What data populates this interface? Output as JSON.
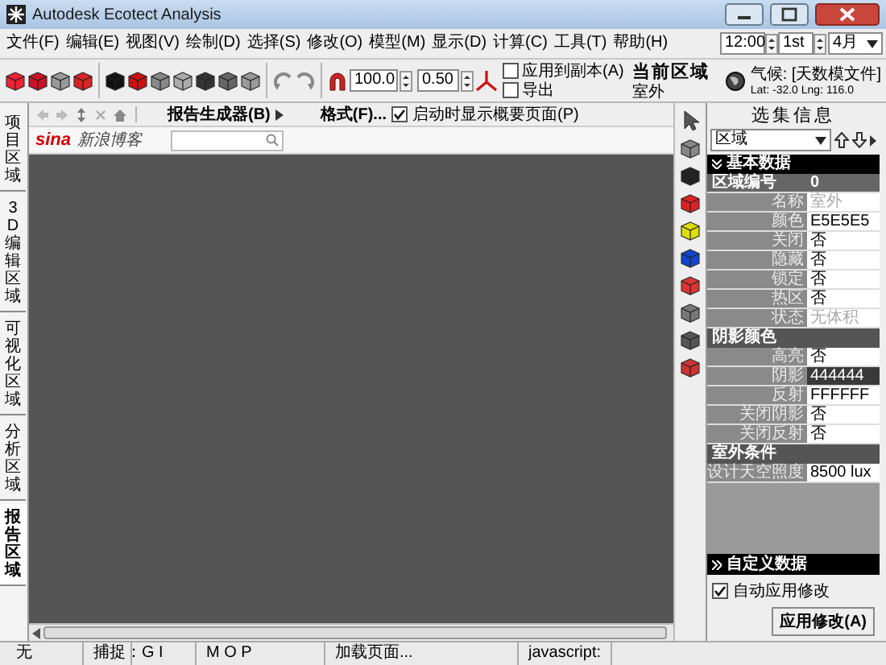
{
  "window": {
    "title": "Autodesk Ecotect Analysis"
  },
  "menu": [
    {
      "label": "文件(F)"
    },
    {
      "label": "编辑(E)"
    },
    {
      "label": "视图(V)"
    },
    {
      "label": "绘制(D)"
    },
    {
      "label": "选择(S)"
    },
    {
      "label": "修改(O)"
    },
    {
      "label": "模型(M)"
    },
    {
      "label": "显示(D)"
    },
    {
      "label": "计算(C)"
    },
    {
      "label": "工具(T)"
    },
    {
      "label": "帮助(H)"
    }
  ],
  "date_time": {
    "time": "12:00",
    "day": "1st",
    "month": "4月"
  },
  "climate": {
    "label": "气候: [天数模文件]",
    "coords": "Lat: -32.0   Lng: 116.0"
  },
  "toolbar": {
    "zoom": "100.0",
    "step": "0.50",
    "apply_copy": {
      "label": "应用到副本(A)",
      "checked": false
    },
    "export": {
      "label": "导出",
      "checked": false
    },
    "zone_title": "当前区域",
    "zone_name": "室外"
  },
  "side_tabs": [
    {
      "label": "项目区域",
      "selected": false
    },
    {
      "label": "3D编辑区域",
      "selected": false
    },
    {
      "label": "可视化区域",
      "selected": false
    },
    {
      "label": "分析区域",
      "selected": false
    },
    {
      "label": "报告区域",
      "selected": true
    }
  ],
  "report_toolbar": {
    "generator": "报告生成器(B)",
    "format": "格式(F)...",
    "show_summary": {
      "label": "启动时显示概要页面(P)",
      "checked": true
    }
  },
  "browser": {
    "logo": "sina",
    "site": "新浪博客"
  },
  "selection_panel": {
    "title": "选集信息",
    "type": "区域",
    "sections": [
      {
        "title": "基本数据",
        "kind": "main",
        "rows": [
          {
            "label": "区域编号",
            "value": "0",
            "kind": "id"
          },
          {
            "label": "名称",
            "value": "室外",
            "kind": "muted"
          },
          {
            "label": "颜色",
            "value": "E5E5E5",
            "kind": "plain"
          },
          {
            "label": "关闭",
            "value": "否",
            "kind": "plain"
          },
          {
            "label": "隐藏",
            "value": "否",
            "kind": "plain"
          },
          {
            "label": "锁定",
            "value": "否",
            "kind": "plain"
          },
          {
            "label": "热区",
            "value": "否",
            "kind": "plain"
          },
          {
            "label": "状态",
            "value": "无体积",
            "kind": "muted"
          }
        ]
      },
      {
        "title": "阴影颜色",
        "kind": "sub",
        "rows": [
          {
            "label": "高亮",
            "value": "否",
            "kind": "plain"
          },
          {
            "label": "阴影",
            "value": "444444",
            "kind": "dark"
          },
          {
            "label": "反射",
            "value": "FFFFFF",
            "kind": "plain"
          },
          {
            "label": "关闭阴影",
            "value": "否",
            "kind": "plain"
          },
          {
            "label": "关闭反射",
            "value": "否",
            "kind": "plain"
          }
        ]
      },
      {
        "title": "室外条件",
        "kind": "sub",
        "rows": [
          {
            "label": "设计天空照度",
            "value": "8500 lux",
            "kind": "plain"
          }
        ]
      }
    ],
    "custom_data": "自定义数据",
    "auto_apply": {
      "label": "自动应用修改",
      "checked": true
    },
    "apply_button": "应用修改(A)"
  },
  "status_bar": [
    {
      "text": "无"
    },
    {
      "text": "捕捉："
    },
    {
      "text": "G I"
    },
    {
      "text": "M O P"
    },
    {
      "text": "加载页面..."
    },
    {
      "text": "javascript:"
    }
  ]
}
